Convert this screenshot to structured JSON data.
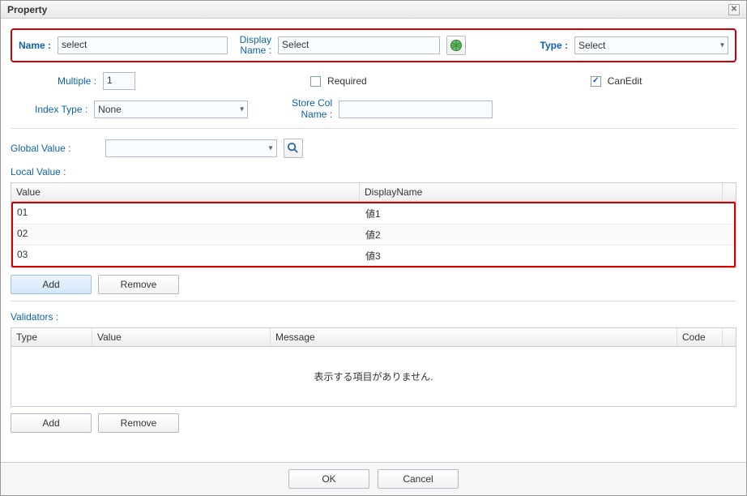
{
  "window": {
    "title": "Property"
  },
  "h": {
    "name_label": "Name :",
    "name_value": "select",
    "display_name_label_1": "Display",
    "display_name_label_2": "Name :",
    "display_name_value": "Select",
    "type_label": "Type :",
    "type_value": "Select"
  },
  "opts": {
    "multiple_label": "Multiple :",
    "multiple_value": "1",
    "required_label": "Required",
    "canedit_label": "CanEdit",
    "index_type_label": "Index Type :",
    "index_type_value": "None",
    "store_col_label_1": "Store Col",
    "store_col_label_2": "Name :",
    "store_col_value": ""
  },
  "global_value": {
    "label": "Global Value :",
    "value": ""
  },
  "local_value": {
    "label": "Local Value :",
    "headers": {
      "value": "Value",
      "display_name": "DisplayName"
    },
    "rows": [
      {
        "value": "01",
        "display_name": "値1"
      },
      {
        "value": "02",
        "display_name": "値2"
      },
      {
        "value": "03",
        "display_name": "値3"
      }
    ],
    "add": "Add",
    "remove": "Remove"
  },
  "validators": {
    "label": "Validators :",
    "headers": {
      "type": "Type",
      "value": "Value",
      "message": "Message",
      "code": "Code"
    },
    "empty_text": "表示する項目がありません.",
    "add": "Add",
    "remove": "Remove"
  },
  "footer": {
    "ok": "OK",
    "cancel": "Cancel"
  }
}
